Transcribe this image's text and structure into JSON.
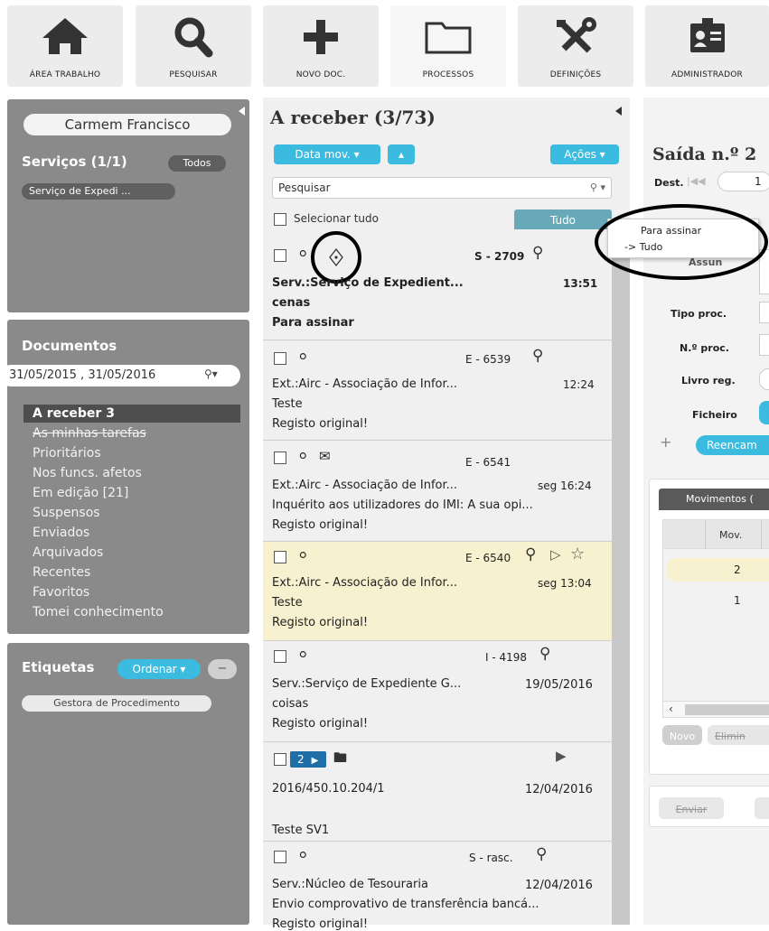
{
  "toolbar": [
    {
      "label": "ÁREA TRABALHO",
      "icon": "home-icon"
    },
    {
      "label": "PESQUISAR",
      "icon": "search-icon"
    },
    {
      "label": "NOVO DOC.",
      "icon": "plus-icon"
    },
    {
      "label": "PROCESSOS",
      "icon": "folder-icon"
    },
    {
      "label": "DEFINIÇÕES",
      "icon": "tools-icon"
    },
    {
      "label": "ADMINISTRADOR",
      "icon": "id-card-icon"
    }
  ],
  "user_panel": {
    "user_name": "Carmem Francisco",
    "services_title": "Serviços (1/1)",
    "all_button": "Todos",
    "service_item": "Serviço de Expedi ..."
  },
  "documents_panel": {
    "title": "Documentos",
    "date_range": "31/05/2015 , 31/05/2016",
    "nav": [
      "A receber 3",
      "As minhas tarefas",
      "Prioritários",
      "Nos funcs. afetos",
      "Em edição [21]",
      "Suspensos",
      "Enviados",
      "Arquivados",
      "Recentes",
      "Favoritos",
      "Tomei conhecimento"
    ]
  },
  "labels_panel": {
    "title": "Etiquetas",
    "sort_button": "Ordenar",
    "minus_button": "−",
    "tag": "Gestora de Procedimento"
  },
  "list": {
    "title": "A receber (3/73)",
    "sort_button": "Data mov.",
    "actions_button": "Ações",
    "search_placeholder": "Pesquisar",
    "select_all": "Selecionar tudo",
    "filter_tab": "Tudo",
    "items": [
      {
        "ref": "S - 2709",
        "line1": "Serv.:Serviço de Expedient...",
        "time": "13:51",
        "line2": "cenas",
        "line3": "Para assinar"
      },
      {
        "ref": "E - 6539",
        "line1": "Ext.:Airc - Associação de Infor...",
        "time": "12:24",
        "line2": "Teste",
        "line3": "Registo original!"
      },
      {
        "ref": "E - 6541",
        "line1": "Ext.:Airc - Associação de Infor...",
        "time": "seg 16:24",
        "line2": "Inquérito aos utilizadores do IMI: A sua opi...",
        "line3": "Registo original!"
      },
      {
        "ref": "E - 6540",
        "line1": "Ext.:Airc - Associação de Infor...",
        "time": "seg 13:04",
        "line2": "Teste",
        "line3": "Registo original!"
      },
      {
        "ref": "I - 4198",
        "line1": "Serv.:Serviço de Expediente G...",
        "time": "19/05/2016",
        "line2": "coisas",
        "line3": "Registo original!"
      },
      {
        "badge": "2",
        "line1": "2016/450.10.204/1",
        "time": "12/04/2016",
        "line3": "Teste SV1"
      },
      {
        "ref": "S - rasc.",
        "line1": "Serv.:Núcleo de Tesouraria",
        "time": "12/04/2016",
        "line2": "Envio comprovativo de transferência bancá...",
        "line3": "Registo original!"
      }
    ]
  },
  "dropdown": {
    "options": [
      "Para assinar",
      "-> Tudo"
    ]
  },
  "detail": {
    "title": "Saída n.º 2",
    "dest_label": "Dest.",
    "dest_value": "1",
    "assunto_label": "Assun",
    "fields": [
      "Tipo proc.",
      "N.º proc.",
      "Livro reg.",
      "Ficheiro"
    ],
    "reencaminhar": "Reencam",
    "movements_tab": "Movimentos (",
    "mov_header": "Mov.",
    "mov_rows": [
      "2",
      "1"
    ],
    "new_button": "Novo",
    "delete_button": "Elimin",
    "send_button": "Enviar"
  },
  "colors": {
    "accent": "#3bbbe0",
    "panel": "#8a8a8a",
    "highlight_row": "#f7f1cf"
  }
}
